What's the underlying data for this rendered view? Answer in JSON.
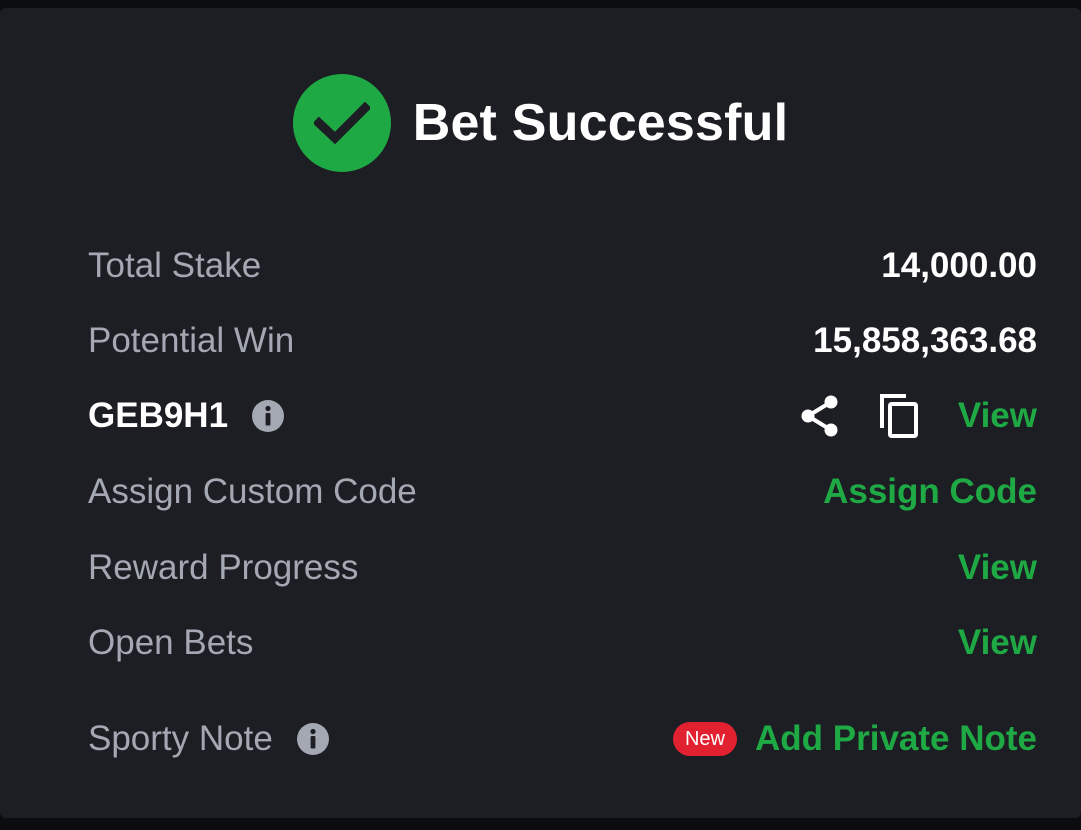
{
  "colors": {
    "accent_green": "#1fa944",
    "badge_red": "#e1212f",
    "panel_bg": "#1c1e24",
    "label_gray": "#a4a8b2"
  },
  "header": {
    "icon": "check-circle-icon",
    "title": "Bet Successful"
  },
  "summary": {
    "total_stake_label": "Total Stake",
    "total_stake_value": "14,000.00",
    "potential_win_label": "Potential Win",
    "potential_win_value": "15,858,363.68"
  },
  "booking": {
    "code": "GEB9H1",
    "info_icon": "info-icon",
    "share_icon": "share-icon",
    "copy_icon": "copy-icon",
    "view_label": "View"
  },
  "custom_code": {
    "label": "Assign Custom Code",
    "action_label": "Assign Code"
  },
  "reward_progress": {
    "label": "Reward Progress",
    "action_label": "View"
  },
  "open_bets": {
    "label": "Open Bets",
    "action_label": "View"
  },
  "sporty_note": {
    "label": "Sporty Note",
    "badge": "New",
    "action_label": "Add Private Note"
  }
}
